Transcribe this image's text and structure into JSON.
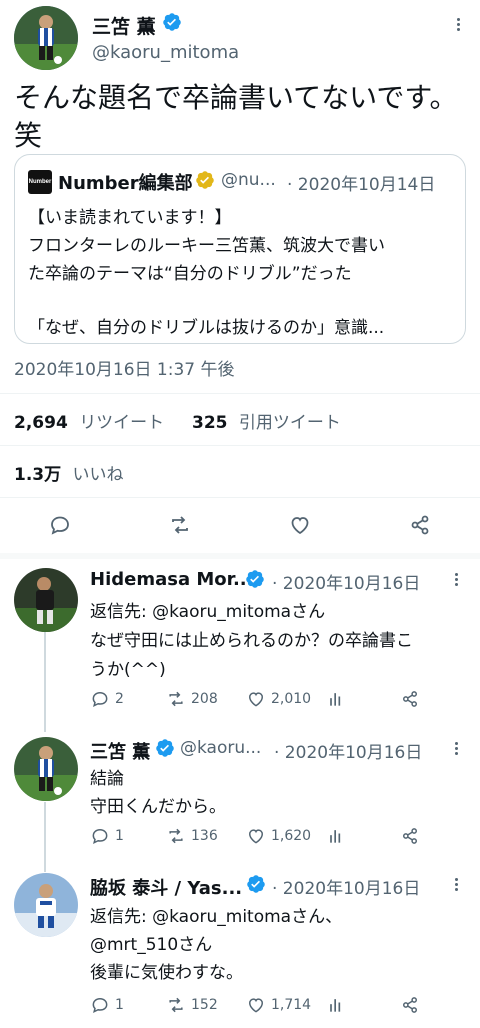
{
  "main_tweet": {
    "author_name": "三笘 薫",
    "handle": "@kaoru_mitoma",
    "text_line1": "そんな題名で卒論書いてないです。",
    "text_line2": "笑",
    "quote": {
      "logo_text": "Number",
      "author_name": "Number編集部",
      "handle": "@nu...",
      "date": "· 2020年10月14日",
      "line1": "【いま読まれています！】",
      "line2": "フロンターレのルーキー三笘薫、筑波大で書い",
      "line3": "た卒論のテーマは“自分のドリブル”だった",
      "line4": "「なぜ、自分のドリブルは抜けるのか」意識..."
    },
    "timestamp": "2020年10月16日 1:37 午後",
    "retweet_count": "2,694",
    "retweet_label": "リツイート",
    "quote_count": "325",
    "quote_label": "引用ツイート",
    "like_count": "1.3万",
    "like_label": "いいね"
  },
  "replies": [
    {
      "author_name": "Hidemasa Mor...",
      "date": "· 2020年10月16日",
      "line1": "返信先: @kaoru_mitomaさん",
      "line2": "なぜ守田には止められるのか？の卒論書こ",
      "line3": "うか(^^)",
      "replies": "2",
      "retweets": "208",
      "likes": "2,010"
    },
    {
      "author_name": "三笘 薫",
      "handle": "@kaoru...",
      "date": "· 2020年10月16日",
      "line1": "結論",
      "line2": "守田くんだから。",
      "replies": "1",
      "retweets": "136",
      "likes": "1,620"
    },
    {
      "author_name": "脇坂 泰斗 / Yas...",
      "date": "· 2020年10月16日",
      "line1": "返信先: @kaoru_mitomaさん、",
      "line2": "@mrt_510さん",
      "line3": "後輩に気使わすな。",
      "replies": "1",
      "retweets": "152",
      "likes": "1,714"
    }
  ],
  "colors": {
    "verified_blue": "#1d9bf0",
    "verified_gold": "#e2b719",
    "text": "#0f1419",
    "secondary": "#536471",
    "divider": "#eff3f4"
  },
  "icons": [
    "verified-icon",
    "more-icon",
    "reply-icon",
    "retweet-icon",
    "like-icon",
    "share-icon",
    "analytics-icon"
  ]
}
